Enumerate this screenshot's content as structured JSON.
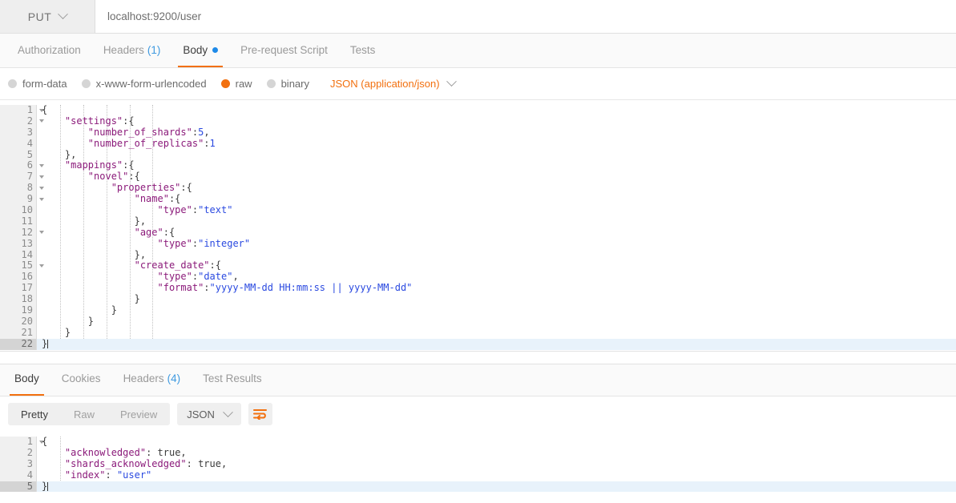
{
  "urlbar": {
    "method": "PUT",
    "url": "localhost:9200/user",
    "method_icon": "chevron-down-icon"
  },
  "request_tabs": [
    {
      "label": "Authorization",
      "count": "",
      "active": false,
      "dot": false
    },
    {
      "label": "Headers",
      "count": "(1)",
      "active": false,
      "dot": false
    },
    {
      "label": "Body",
      "count": "",
      "active": true,
      "dot": true
    },
    {
      "label": "Pre-request Script",
      "count": "",
      "active": false,
      "dot": false
    },
    {
      "label": "Tests",
      "count": "",
      "active": false,
      "dot": false
    }
  ],
  "body_type": {
    "options": [
      {
        "label": "form-data",
        "selected": false
      },
      {
        "label": "x-www-form-urlencoded",
        "selected": false
      },
      {
        "label": "raw",
        "selected": true
      },
      {
        "label": "binary",
        "selected": false
      }
    ],
    "content_type": "JSON (application/json)",
    "content_type_icon": "chevron-down-icon",
    "accent": "#f2700f"
  },
  "request_body": {
    "cursor_line": 22,
    "lines": [
      {
        "n": 1,
        "fold": true,
        "indent": 0,
        "tokens": [
          {
            "t": "{",
            "c": "pun"
          }
        ]
      },
      {
        "n": 2,
        "fold": true,
        "indent": 1,
        "tokens": [
          {
            "t": "\"settings\"",
            "c": "key"
          },
          {
            "t": ":{",
            "c": "pun"
          }
        ]
      },
      {
        "n": 3,
        "fold": false,
        "indent": 2,
        "tokens": [
          {
            "t": "\"number_of_shards\"",
            "c": "key"
          },
          {
            "t": ":",
            "c": "pun"
          },
          {
            "t": "5",
            "c": "num"
          },
          {
            "t": ",",
            "c": "pun"
          }
        ]
      },
      {
        "n": 4,
        "fold": false,
        "indent": 2,
        "tokens": [
          {
            "t": "\"number_of_replicas\"",
            "c": "key"
          },
          {
            "t": ":",
            "c": "pun"
          },
          {
            "t": "1",
            "c": "num"
          }
        ]
      },
      {
        "n": 5,
        "fold": false,
        "indent": 1,
        "tokens": [
          {
            "t": "},",
            "c": "pun"
          }
        ]
      },
      {
        "n": 6,
        "fold": true,
        "indent": 1,
        "tokens": [
          {
            "t": "\"mappings\"",
            "c": "key"
          },
          {
            "t": ":{",
            "c": "pun"
          }
        ]
      },
      {
        "n": 7,
        "fold": true,
        "indent": 2,
        "tokens": [
          {
            "t": "\"novel\"",
            "c": "key"
          },
          {
            "t": ":{",
            "c": "pun"
          }
        ]
      },
      {
        "n": 8,
        "fold": true,
        "indent": 3,
        "tokens": [
          {
            "t": "\"properties\"",
            "c": "key"
          },
          {
            "t": ":{",
            "c": "pun"
          }
        ]
      },
      {
        "n": 9,
        "fold": true,
        "indent": 4,
        "tokens": [
          {
            "t": "\"name\"",
            "c": "key"
          },
          {
            "t": ":{",
            "c": "pun"
          }
        ]
      },
      {
        "n": 10,
        "fold": false,
        "indent": 5,
        "tokens": [
          {
            "t": "\"type\"",
            "c": "key"
          },
          {
            "t": ":",
            "c": "pun"
          },
          {
            "t": "\"text\"",
            "c": "str"
          }
        ]
      },
      {
        "n": 11,
        "fold": false,
        "indent": 4,
        "tokens": [
          {
            "t": "},",
            "c": "pun"
          }
        ]
      },
      {
        "n": 12,
        "fold": true,
        "indent": 4,
        "tokens": [
          {
            "t": "\"age\"",
            "c": "key"
          },
          {
            "t": ":{",
            "c": "pun"
          }
        ]
      },
      {
        "n": 13,
        "fold": false,
        "indent": 5,
        "tokens": [
          {
            "t": "\"type\"",
            "c": "key"
          },
          {
            "t": ":",
            "c": "pun"
          },
          {
            "t": "\"integer\"",
            "c": "str"
          }
        ]
      },
      {
        "n": 14,
        "fold": false,
        "indent": 4,
        "tokens": [
          {
            "t": "},",
            "c": "pun"
          }
        ]
      },
      {
        "n": 15,
        "fold": true,
        "indent": 4,
        "tokens": [
          {
            "t": "\"create_date\"",
            "c": "key"
          },
          {
            "t": ":{",
            "c": "pun"
          }
        ]
      },
      {
        "n": 16,
        "fold": false,
        "indent": 5,
        "tokens": [
          {
            "t": "\"type\"",
            "c": "key"
          },
          {
            "t": ":",
            "c": "pun"
          },
          {
            "t": "\"date\"",
            "c": "str"
          },
          {
            "t": ",",
            "c": "pun"
          }
        ]
      },
      {
        "n": 17,
        "fold": false,
        "indent": 5,
        "tokens": [
          {
            "t": "\"format\"",
            "c": "key"
          },
          {
            "t": ":",
            "c": "pun"
          },
          {
            "t": "\"yyyy-MM-dd HH:mm:ss || yyyy-MM-dd\"",
            "c": "str"
          }
        ]
      },
      {
        "n": 18,
        "fold": false,
        "indent": 4,
        "tokens": [
          {
            "t": "}",
            "c": "pun"
          }
        ]
      },
      {
        "n": 19,
        "fold": false,
        "indent": 3,
        "tokens": [
          {
            "t": "}",
            "c": "pun"
          }
        ]
      },
      {
        "n": 20,
        "fold": false,
        "indent": 2,
        "tokens": [
          {
            "t": "}",
            "c": "pun"
          }
        ]
      },
      {
        "n": 21,
        "fold": false,
        "indent": 1,
        "tokens": [
          {
            "t": "}",
            "c": "pun"
          }
        ]
      },
      {
        "n": 22,
        "fold": false,
        "indent": 0,
        "tokens": [
          {
            "t": "}",
            "c": "pun"
          }
        ]
      }
    ]
  },
  "response_tabs": [
    {
      "label": "Body",
      "count": "",
      "active": true
    },
    {
      "label": "Cookies",
      "count": "",
      "active": false
    },
    {
      "label": "Headers",
      "count": "(4)",
      "active": false
    },
    {
      "label": "Test Results",
      "count": "",
      "active": false
    }
  ],
  "response_toolbar": {
    "view_modes": [
      {
        "label": "Pretty",
        "active": true
      },
      {
        "label": "Raw",
        "active": false
      },
      {
        "label": "Preview",
        "active": false
      }
    ],
    "format": "JSON",
    "format_icon": "chevron-down-icon",
    "wrap_icon": "word-wrap-icon"
  },
  "response_body": {
    "cursor_line": 5,
    "lines": [
      {
        "n": 1,
        "fold": true,
        "indent": 0,
        "tokens": [
          {
            "t": "{",
            "c": "pun"
          }
        ]
      },
      {
        "n": 2,
        "fold": false,
        "indent": 1,
        "tokens": [
          {
            "t": "\"acknowledged\"",
            "c": "key"
          },
          {
            "t": ": ",
            "c": "pun"
          },
          {
            "t": "true",
            "c": "bool"
          },
          {
            "t": ",",
            "c": "pun"
          }
        ]
      },
      {
        "n": 3,
        "fold": false,
        "indent": 1,
        "tokens": [
          {
            "t": "\"shards_acknowledged\"",
            "c": "key"
          },
          {
            "t": ": ",
            "c": "pun"
          },
          {
            "t": "true",
            "c": "bool"
          },
          {
            "t": ",",
            "c": "pun"
          }
        ]
      },
      {
        "n": 4,
        "fold": false,
        "indent": 1,
        "tokens": [
          {
            "t": "\"index\"",
            "c": "key"
          },
          {
            "t": ": ",
            "c": "pun"
          },
          {
            "t": "\"user\"",
            "c": "str"
          }
        ]
      },
      {
        "n": 5,
        "fold": false,
        "indent": 0,
        "tokens": [
          {
            "t": "}",
            "c": "pun"
          }
        ]
      }
    ]
  }
}
